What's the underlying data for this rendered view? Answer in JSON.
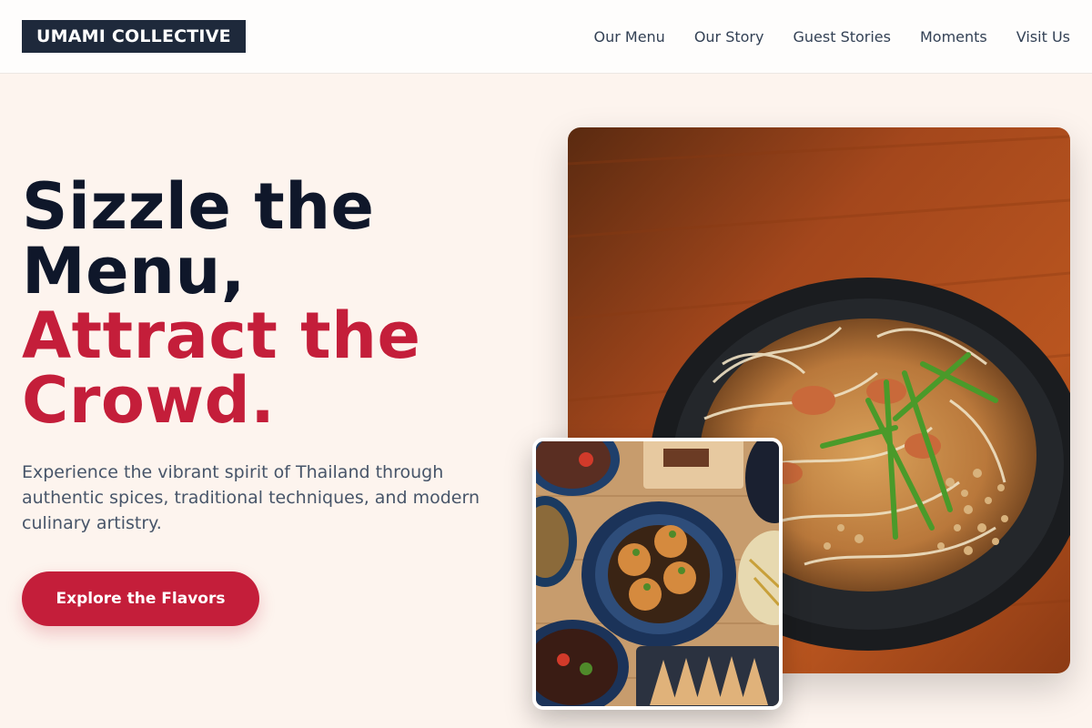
{
  "brand": {
    "name": "UMAMI COLLECTIVE"
  },
  "nav": {
    "items": [
      {
        "label": "Our Menu"
      },
      {
        "label": "Our Story"
      },
      {
        "label": "Guest Stories"
      },
      {
        "label": "Moments"
      },
      {
        "label": "Visit Us"
      }
    ]
  },
  "hero": {
    "headline_line1": "Sizzle the",
    "headline_line2": "Menu,",
    "headline_line3": "Attract the",
    "headline_line4": "Crowd.",
    "description": "Experience the vibrant spirit of Thailand through authentic spices, traditional techniques, and modern culinary artistry.",
    "cta_label": "Explore the Flavors"
  },
  "images": {
    "main_photo": "pad-thai-photo",
    "secondary_photo": "thai-dishes-spread-photo"
  },
  "colors": {
    "accent": "#c41e3a",
    "dark": "#0f172a",
    "background": "#fdf4ee",
    "logo_bg": "#1e293b"
  }
}
